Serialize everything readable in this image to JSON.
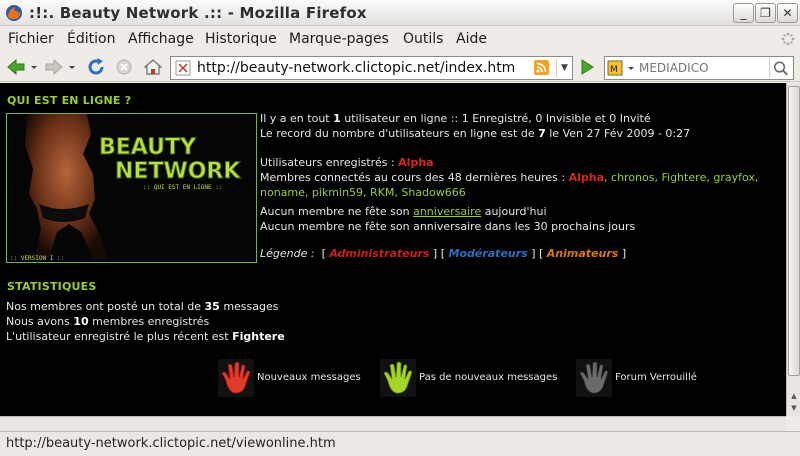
{
  "window": {
    "title": ":!:. Beauty Network .:: - Mozilla Firefox",
    "btn_minimize": "_",
    "btn_restore": "❐",
    "btn_close": "✕"
  },
  "menu": {
    "items": [
      "Fichier",
      "Édition",
      "Affichage",
      "Historique",
      "Marque-pages",
      "Outils",
      "Aide"
    ]
  },
  "nav": {
    "url": "http://beauty-network.clictopic.net/index.htm",
    "search_placeholder": "MEDIADICO"
  },
  "page": {
    "who_online_title": "QUI EST EN LIGNE ?",
    "banner": {
      "line1": "BEAUTY",
      "line2": "NETWORK",
      "tagline": ":: QUI EST EN LIGNE ::",
      "version": ":: VERSION I ::"
    },
    "online_line1_pre": "Il y a en tout ",
    "online_count": "1",
    "online_line1_post": " utilisateur en ligne :: 1 Enregistré, 0 Invisible et 0 Invité",
    "record_pre": "Le record du nombre d'utilisateurs en ligne est de ",
    "record_count": "7",
    "record_post": " le Ven 27 Fév 2009 - 0:27",
    "registered_label": "Utilisateurs enregistrés : ",
    "registered_user": "Alpha",
    "last48_label": "Membres connectés au cours des 48 dernières heures : ",
    "last48_admin": "Alpha",
    "last48_users_line1": ", chronos, Fighterе, grayfox,",
    "last48_users_line2": "noname, pikmin59, RKM, Shadow666",
    "birthday_pre": "Aucun membre ne fête son ",
    "birthday_link": "anniversaire",
    "birthday_post": " aujourd'hui",
    "birthday_next": "Aucun membre ne fête son anniversaire dans les 30 prochains jours",
    "legend_label": "Légende :",
    "legend_admin": "Administrateurs",
    "legend_mod": "Modérateurs",
    "legend_anim": "Animateurs",
    "stats_title": "STATISTIQUES",
    "stats_posts_pre": "Nos membres ont posté un total de ",
    "stats_posts": "35",
    "stats_posts_post": " messages",
    "stats_members_pre": "Nous avons ",
    "stats_members": "10",
    "stats_members_post": " membres enregistrés",
    "stats_newest_pre": "L'utilisateur enregistré le plus récent est ",
    "stats_newest": "Fighterе",
    "icon_new": "Nouveaux messages",
    "icon_nonew": "Pas de nouveaux messages",
    "icon_locked": "Forum Verrouillé"
  },
  "status": {
    "text": "http://beauty-network.clictopic.net/viewonline.htm"
  },
  "colors": {
    "accent_green": "#9acd32",
    "admin_red": "#d4281e",
    "mod_blue": "#2c6fbf",
    "anim_orange": "#d9781b"
  }
}
